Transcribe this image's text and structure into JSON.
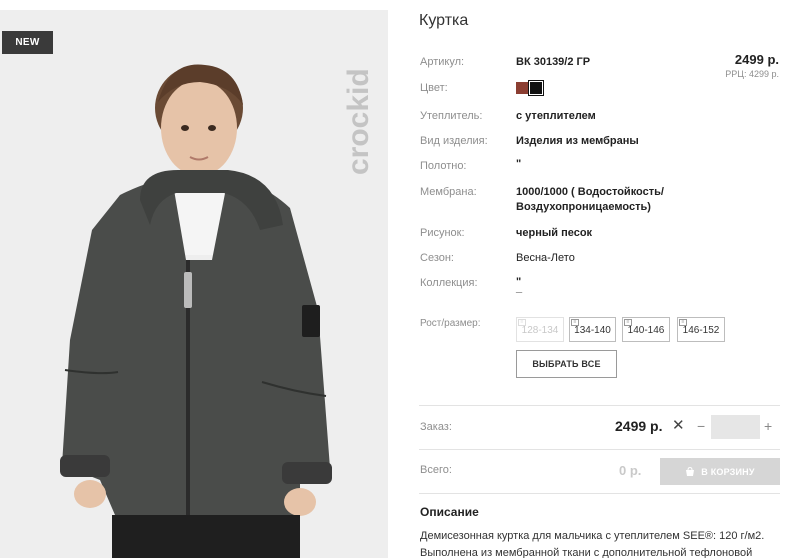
{
  "badge": {
    "new": "NEW"
  },
  "brand": {
    "logo_text": "crockid"
  },
  "product": {
    "title": "Куртка",
    "price": "2499 р.",
    "rrp": "РРЦ: 4299 р."
  },
  "specs": [
    {
      "label": "Артикул:",
      "value": "ВК 30139/2 ГР"
    },
    {
      "label": "Цвет:",
      "value": ""
    },
    {
      "label": "Утеплитель:",
      "value": "с утеплителем"
    },
    {
      "label": "Вид изделия:",
      "value": "Изделия из мембраны"
    },
    {
      "label": "Полотно:",
      "value": "\""
    },
    {
      "label": "Мембрана:",
      "value_line1": "1000/1000 ( Водостойкость/",
      "value_line2": "Воздухопроницаемость)"
    },
    {
      "label": "Рисунок:",
      "value": "черный песок"
    },
    {
      "label": "Сезон:",
      "value": "Весна-Лето"
    },
    {
      "label": "Коллекция:",
      "value_line1": "\"",
      "value_line2": "_"
    }
  ],
  "colors": [
    {
      "name": "brown",
      "hex": "#8b3e32"
    },
    {
      "name": "black",
      "hex": "#111111",
      "selected": true
    }
  ],
  "sizes": {
    "label": "Рост/размер:",
    "options": [
      {
        "label": "128-134",
        "available": false
      },
      {
        "label": "134-140",
        "available": true
      },
      {
        "label": "140-146",
        "available": true
      },
      {
        "label": "146-152",
        "available": true
      }
    ],
    "select_all": "ВЫБРАТЬ ВСЕ"
  },
  "order": {
    "label": "Заказ:",
    "price": "2499 р.",
    "times": "✕",
    "minus": "−",
    "plus": "+",
    "quantity": ""
  },
  "total": {
    "label": "Всего:",
    "value": "0 р.",
    "cart_button": "В КОРЗИНУ"
  },
  "description": {
    "title": "Описание",
    "line1": "Демисезонная куртка для мальчика с утеплителем SEE®: 120 г/м2.",
    "line2": "Выполнена из мембранной ткани с дополнительной тефлоновой"
  },
  "icons": [
    "cart-icon",
    "size-chart-icon"
  ],
  "accent_colors": {
    "badge": "#3a3a3a",
    "button_disabled": "#d6d6d6"
  }
}
